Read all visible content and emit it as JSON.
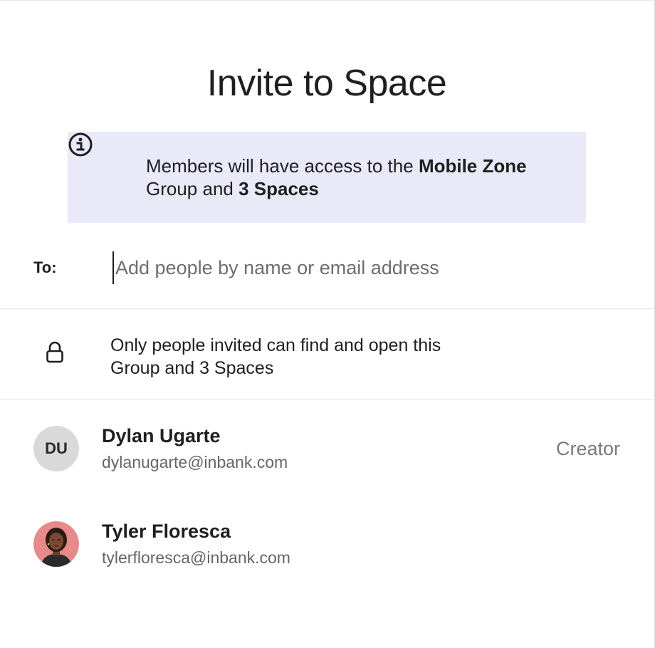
{
  "dialog": {
    "title": "Invite to Space"
  },
  "banner": {
    "icon": "info-icon",
    "text_prefix": "Members will have access to the ",
    "group_name": "Mobile Zone",
    "text_middle": "Group and ",
    "spaces_count": "3 Spaces",
    "background": "#e9e9f8"
  },
  "to_field": {
    "label": "To:",
    "placeholder": "Add people by name or email address",
    "value": ""
  },
  "privacy": {
    "icon": "lock-icon",
    "line1": "Only people invited can find and open this",
    "line2": "Group and 3 Spaces"
  },
  "members": [
    {
      "initials": "DU",
      "name": "Dylan Ugarte",
      "email": "dylanugarte@inbank.com",
      "role": "Creator"
    },
    {
      "avatar": "photo-avatar",
      "name": "Tyler Floresca",
      "email": "tylerfloresca@inbank.com",
      "role": ""
    }
  ]
}
